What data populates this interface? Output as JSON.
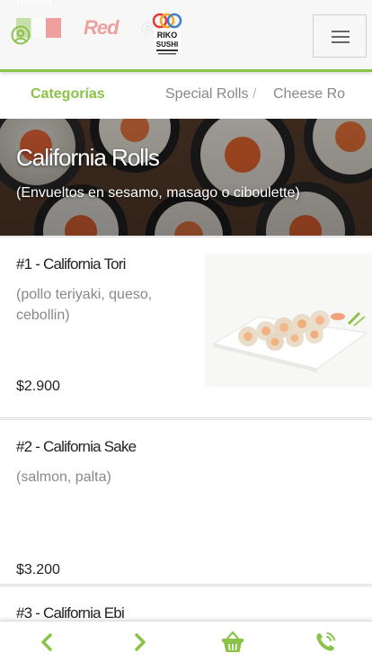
{
  "header": {
    "menu_ghost": "Menu",
    "banner_ghost_text": "Red",
    "banner_ghost_text2": "com",
    "logo_text": "RIKO SUSHI"
  },
  "tabs": [
    {
      "label": "Categorías",
      "active": true
    },
    {
      "label": "Special Rolls",
      "active": false
    },
    {
      "label": "Cheese Ro",
      "active": false
    }
  ],
  "tab_separator": "/",
  "hero": {
    "title": "California Rolls",
    "subtitle": "(Envueltos en sesamo, masago o ciboulette)"
  },
  "products": [
    {
      "name": "#1 - California Tori",
      "description": "(pollo teriyaki, queso, cebollin)",
      "price": "$2.900"
    },
    {
      "name": "#2 - California Sake",
      "description": "(salmon, palta)",
      "price": "$3.200"
    },
    {
      "name": "#3 - California Ebi"
    }
  ],
  "colors": {
    "accent": "#8bc34a",
    "text": "#222222",
    "muted": "#888888"
  },
  "icons": {
    "user": "user-circle-icon",
    "menu": "hamburger-icon",
    "back": "chevron-left-icon",
    "forward": "chevron-right-icon",
    "cart": "basket-icon",
    "phone": "phone-icon"
  }
}
